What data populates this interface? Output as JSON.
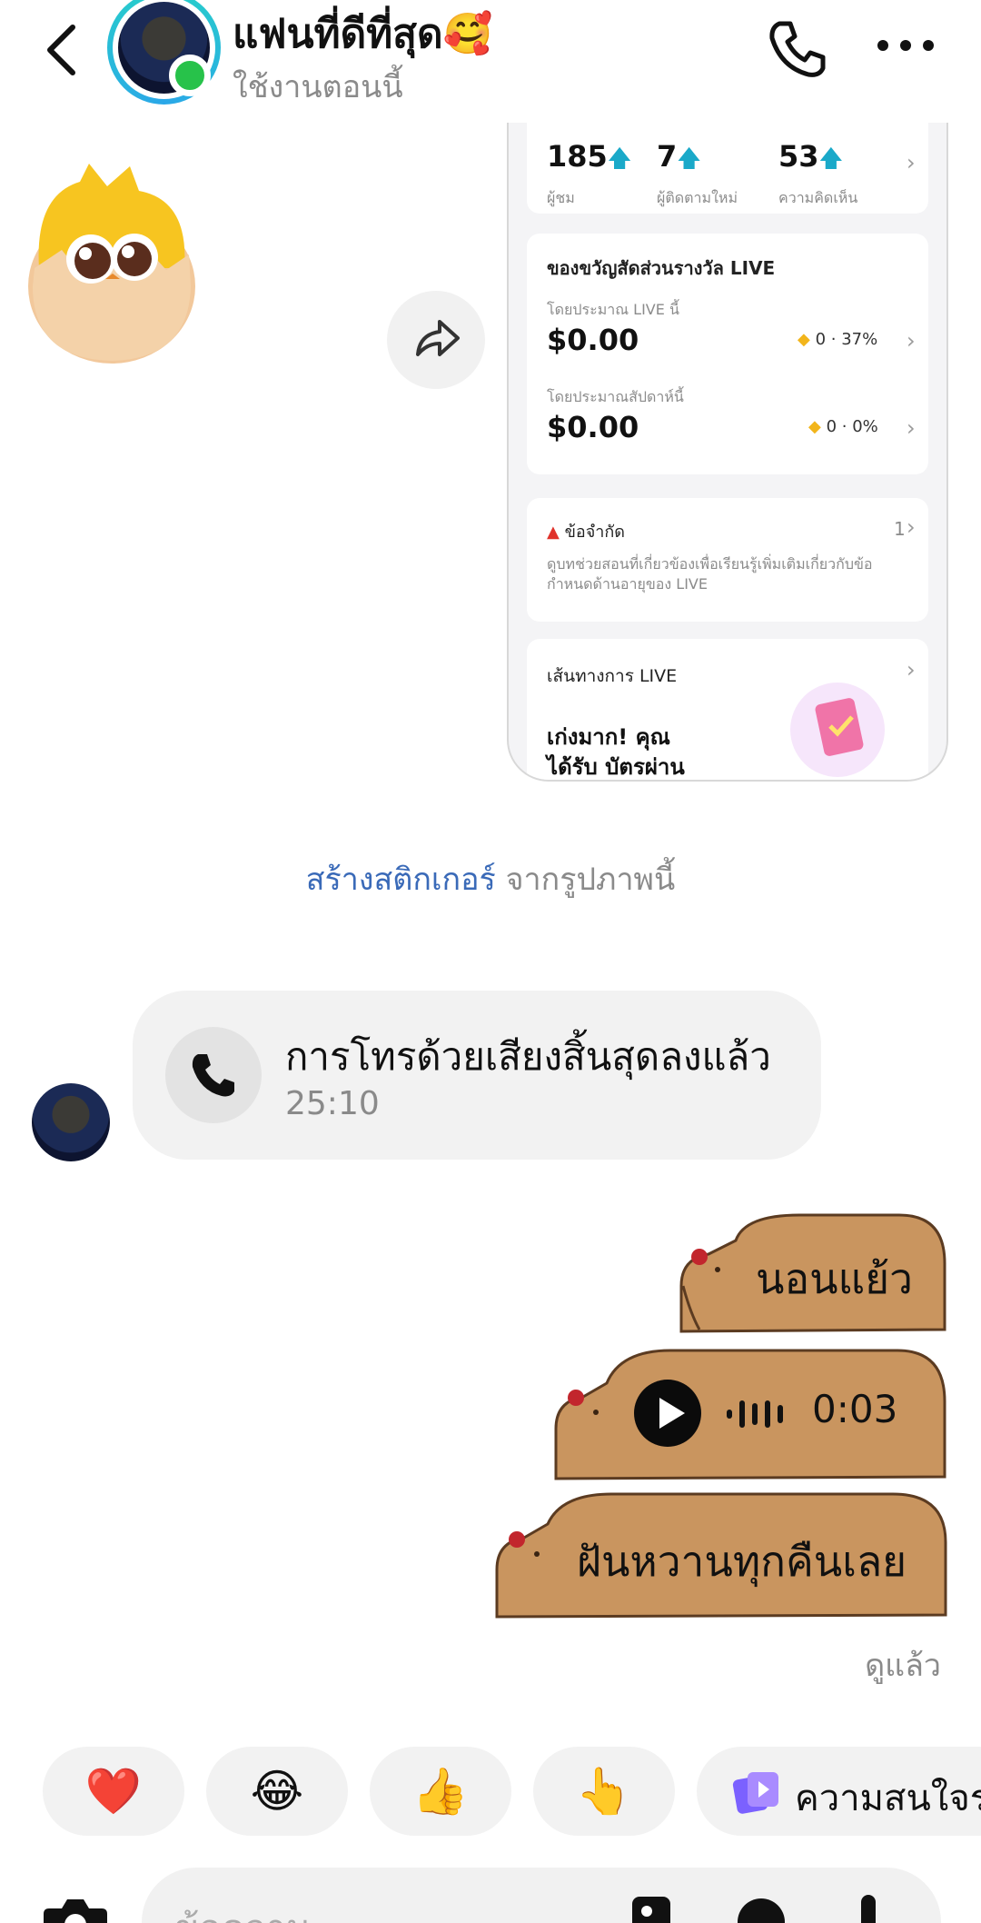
{
  "header": {
    "title": "แฟนที่ดีที่สุด🥰",
    "status": "ใช้งานตอนนี้"
  },
  "screenshot": {
    "stats": [
      {
        "value": "185",
        "label": "ผู้ชม"
      },
      {
        "value": "7",
        "label": "ผู้ติดตามใหม่"
      },
      {
        "value": "53",
        "label": "ความคิดเห็น"
      }
    ],
    "rewards_title": "ของขวัญสัดส่วนรางวัล LIVE",
    "this_live_label": "โดยประมาณ LIVE นี้",
    "this_live_amount": "$0.00",
    "this_live_stats": "0 · 37%",
    "this_week_label": "โดยประมาณสัปดาห์นี้",
    "this_week_amount": "$0.00",
    "this_week_stats": "0 · 0%",
    "limit_title": "ข้อจำกัด",
    "limit_count": "1",
    "limit_desc": "ดูบทช่วยสอนที่เกี่ยวข้องเพื่อเรียนรู้เพิ่มเติมเกี่ยวกับข้อกำหนดด้านอายุของ LIVE",
    "path_title": "เส้นทางการ LIVE",
    "path_text_1": "เก่งมาก! คุณ",
    "path_text_2": "ได้รับ บัตรผ่าน"
  },
  "sticker_link": {
    "link": "สร้างสติกเกอร์",
    "rest": " จากรูปภาพนี้"
  },
  "call": {
    "title": "การโทรด้วยเสียงสิ้นสุดลงแล้ว",
    "duration": "25:10"
  },
  "messages": {
    "msg1": "นอนแย้ว",
    "voice_duration": "0:03",
    "msg3": "ฝันหวานทุกคืนเลย"
  },
  "seen": "ดูแล้ว",
  "reactions": [
    "❤️",
    "😂",
    "👍",
    "👆"
  ],
  "interest_label": "ความสนใจร่",
  "composer": {
    "placeholder": "ข้อความ"
  },
  "colors": {
    "accent_link": "#3a6ab8",
    "online": "#27c24a",
    "capybara": "#c9955f"
  }
}
